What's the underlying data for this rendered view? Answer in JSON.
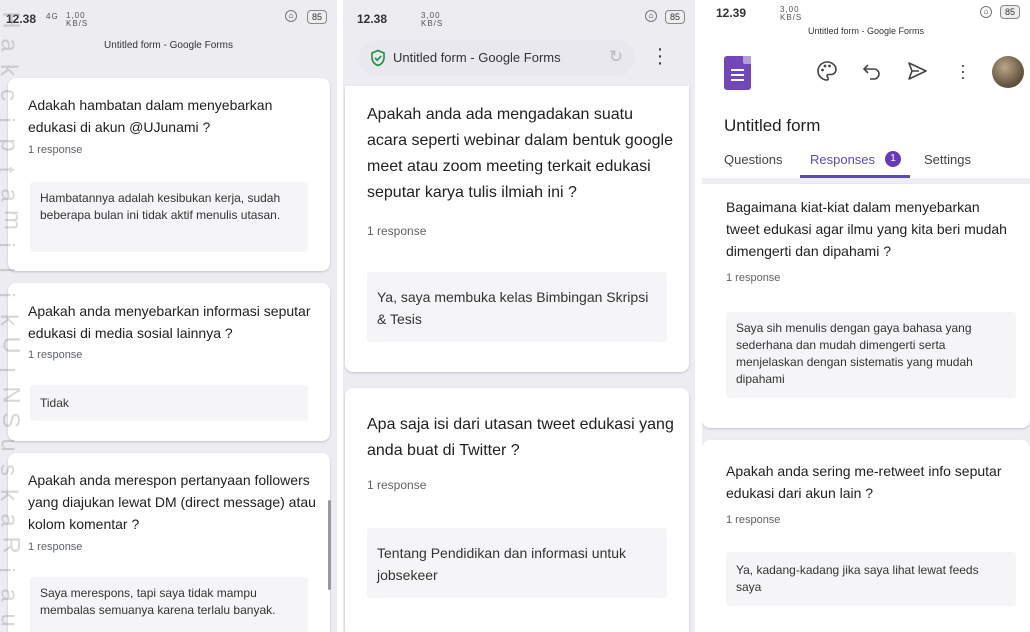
{
  "screen1": {
    "status_time": "12.38",
    "status_signal": "4G",
    "status_speed": "1,00 KB/S",
    "battery": "85",
    "page_title": "Untitled form - Google Forms",
    "cards": [
      {
        "question": "Adakah hambatan dalam menyebarkan edukasi di akun @UJunami ?",
        "responses": "1 response",
        "answer": "Hambatannya adalah kesibukan kerja, sudah beberapa bulan ini tidak aktif menulis utasan."
      },
      {
        "question": "Apakah anda menyebarkan informasi seputar edukasi di media sosial lainnya ?",
        "responses": "1 response",
        "answer": "Tidak"
      },
      {
        "question": "Apakah anda merespon pertanyaan followers yang diajukan lewat DM (direct message) atau kolom komentar ?",
        "responses": "1 response",
        "answer": "Saya merespons, tapi saya tidak mampu membalas semuanya karena terlalu banyak."
      }
    ]
  },
  "screen2": {
    "status_time": "12.38",
    "status_speed": "3,00 KB/S",
    "battery": "85",
    "url_title": "Untitled form - Google Forms",
    "cards": [
      {
        "question": "Apakah anda ada mengadakan suatu acara seperti webinar dalam bentuk google meet atau zoom meeting terkait edukasi seputar karya tulis ilmiah ini ?",
        "responses": "1 response",
        "answer": "Ya, saya membuka kelas Bimbingan Skripsi & Tesis"
      },
      {
        "question": "Apa saja isi dari utasan tweet edukasi yang anda buat di Twitter ?",
        "responses": "1 response",
        "answer": "Tentang Pendidikan dan informasi untuk jobsekeer"
      }
    ]
  },
  "screen3": {
    "status_time": "12.39",
    "status_speed": "3,00 KB/S",
    "battery": "85",
    "page_title": "Untitled form - Google Forms",
    "form_title": "Untitled form",
    "tabs": {
      "questions": "Questions",
      "responses": "Responses",
      "responses_badge": "1",
      "settings": "Settings"
    },
    "cards": [
      {
        "question": "Bagaimana kiat-kiat dalam menyebarkan tweet edukasi agar ilmu yang kita beri mudah dimengerti dan dipahami ?",
        "responses": "1 response",
        "answer": "Saya sih menulis dengan gaya bahasa yang sederhana dan mudah dimengerti serta menjelaskan dengan sistematis yang mudah dipahami"
      },
      {
        "question": "Apakah anda sering me-retweet info seputar edukasi dari akun lain ?",
        "responses": "1 response",
        "answer": "Ya, kadang-kadang jika saya lihat lewat feeds saya"
      }
    ]
  },
  "colors": {
    "accent": "#673ab7",
    "tab_active": "#5b4bb7",
    "badge": "#673ab7",
    "shield": "#1e8e3e"
  },
  "watermark": {
    "letters": [
      "H",
      "a",
      "k",
      "c",
      "i",
      "p",
      "t",
      "a",
      "m",
      "i",
      "l",
      "i",
      "k",
      "U",
      "I",
      "N",
      "S",
      "u",
      "s",
      "k",
      "a",
      "R",
      "i",
      "a",
      "u"
    ]
  }
}
